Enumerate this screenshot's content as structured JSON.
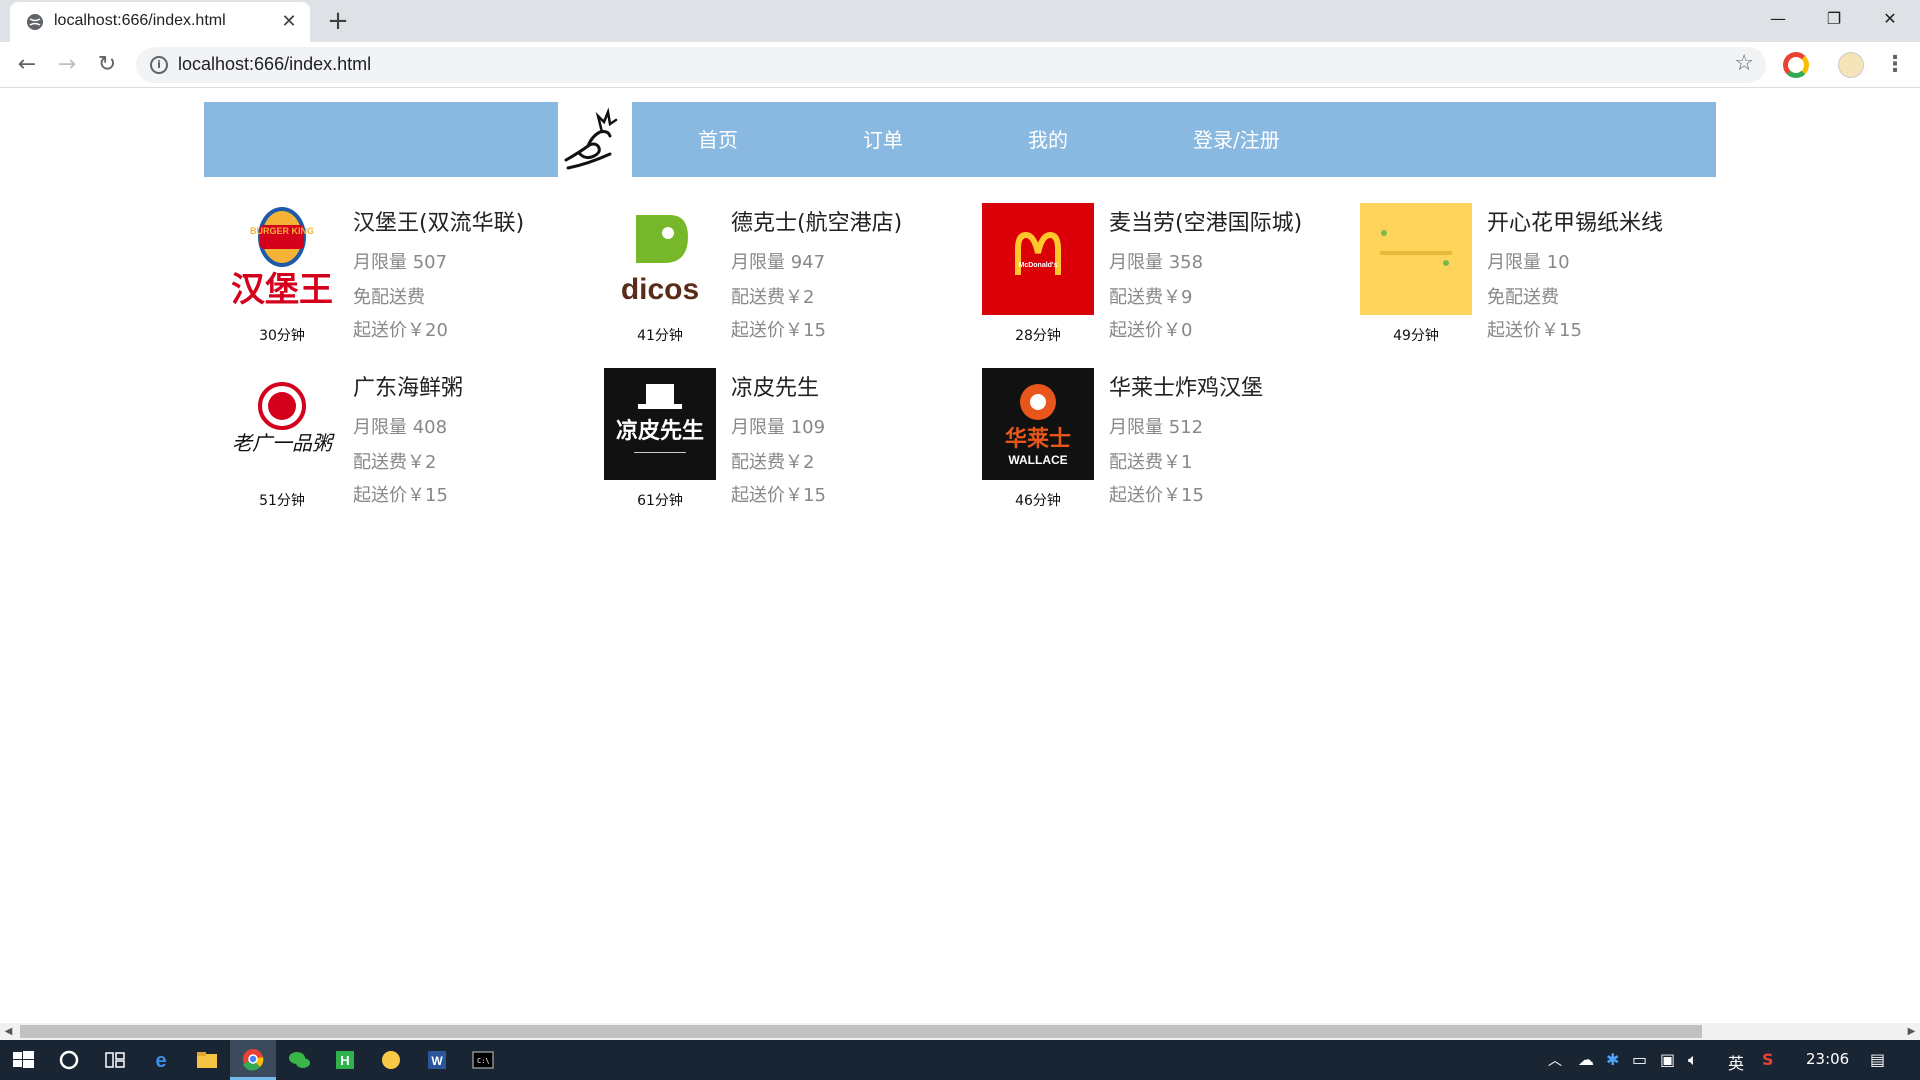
{
  "browser": {
    "tab_title": "localhost:666/index.html",
    "url": "localhost:666/index.html"
  },
  "nav": {
    "home": "首页",
    "orders": "订单",
    "mine": "我的",
    "login": "登录/注册"
  },
  "stores": [
    {
      "name": "汉堡王(双流华联)",
      "monthly": "月限量 507",
      "delivery": "免配送费",
      "min_order": "起送价￥20",
      "time": "30分钟",
      "logo": "burger-king-logo",
      "color": "#ffffff"
    },
    {
      "name": "德克士(航空港店)",
      "monthly": "月限量 947",
      "delivery": "配送费￥2",
      "min_order": "起送价￥15",
      "time": "41分钟",
      "logo": "dicos-logo",
      "color": "#ffffff"
    },
    {
      "name": "麦当劳(空港国际城)",
      "monthly": "月限量 358",
      "delivery": "配送费￥9",
      "min_order": "起送价￥0",
      "time": "28分钟",
      "logo": "mcdonalds-logo",
      "color": "#db0007"
    },
    {
      "name": "开心花甲锡纸米线",
      "monthly": "月限量 10",
      "delivery": "免配送费",
      "min_order": "起送价￥15",
      "time": "49分钟",
      "logo": "kaixin-logo",
      "color": "#ffd45a"
    },
    {
      "name": "广东海鲜粥",
      "monthly": "月限量 408",
      "delivery": "配送费￥2",
      "min_order": "起送价￥15",
      "time": "51分钟",
      "logo": "porridge-logo",
      "color": "#ffffff"
    },
    {
      "name": "凉皮先生",
      "monthly": "月限量 109",
      "delivery": "配送费￥2",
      "min_order": "起送价￥15",
      "time": "61分钟",
      "logo": "liangpi-logo",
      "color": "#111111"
    },
    {
      "name": "华莱士炸鸡汉堡",
      "monthly": "月限量 512",
      "delivery": "配送费￥1",
      "min_order": "起送价￥15",
      "time": "46分钟",
      "logo": "wallace-logo",
      "color": "#111111"
    }
  ],
  "logo_text": {
    "burger_king_top": "BURGER KING",
    "burger_king_cn": "汉堡王",
    "dicos": "dicos",
    "mcdonalds": "McDonald's",
    "liangpi": "凉皮先生",
    "porridge": "老广一品粥",
    "wallace_cn": "华莱士",
    "wallace": "WALLACE"
  },
  "taskbar": {
    "ime": "英",
    "clock": "23:06"
  },
  "colors": {
    "header_blue": "#89b8e0",
    "accent_red": "#d5001c"
  }
}
